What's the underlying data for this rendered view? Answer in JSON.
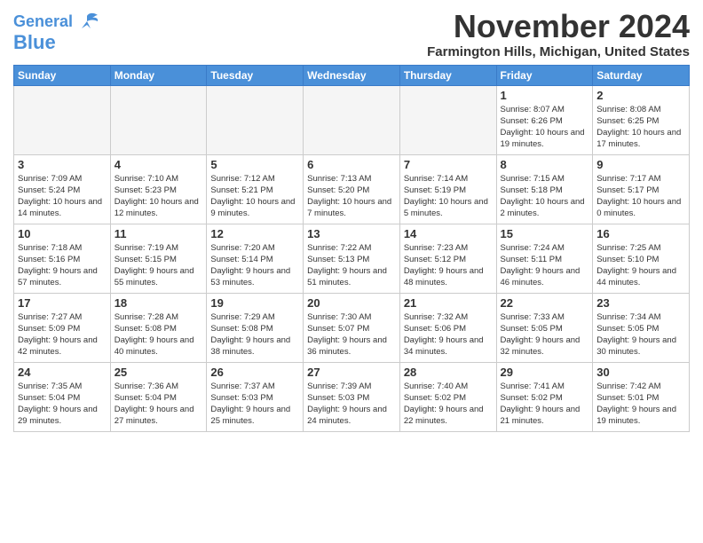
{
  "header": {
    "logo_line1": "General",
    "logo_line2": "Blue",
    "month": "November 2024",
    "location": "Farmington Hills, Michigan, United States"
  },
  "weekdays": [
    "Sunday",
    "Monday",
    "Tuesday",
    "Wednesday",
    "Thursday",
    "Friday",
    "Saturday"
  ],
  "weeks": [
    [
      {
        "day": "",
        "info": ""
      },
      {
        "day": "",
        "info": ""
      },
      {
        "day": "",
        "info": ""
      },
      {
        "day": "",
        "info": ""
      },
      {
        "day": "",
        "info": ""
      },
      {
        "day": "1",
        "info": "Sunrise: 8:07 AM\nSunset: 6:26 PM\nDaylight: 10 hours and 19 minutes."
      },
      {
        "day": "2",
        "info": "Sunrise: 8:08 AM\nSunset: 6:25 PM\nDaylight: 10 hours and 17 minutes."
      }
    ],
    [
      {
        "day": "3",
        "info": "Sunrise: 7:09 AM\nSunset: 5:24 PM\nDaylight: 10 hours and 14 minutes."
      },
      {
        "day": "4",
        "info": "Sunrise: 7:10 AM\nSunset: 5:23 PM\nDaylight: 10 hours and 12 minutes."
      },
      {
        "day": "5",
        "info": "Sunrise: 7:12 AM\nSunset: 5:21 PM\nDaylight: 10 hours and 9 minutes."
      },
      {
        "day": "6",
        "info": "Sunrise: 7:13 AM\nSunset: 5:20 PM\nDaylight: 10 hours and 7 minutes."
      },
      {
        "day": "7",
        "info": "Sunrise: 7:14 AM\nSunset: 5:19 PM\nDaylight: 10 hours and 5 minutes."
      },
      {
        "day": "8",
        "info": "Sunrise: 7:15 AM\nSunset: 5:18 PM\nDaylight: 10 hours and 2 minutes."
      },
      {
        "day": "9",
        "info": "Sunrise: 7:17 AM\nSunset: 5:17 PM\nDaylight: 10 hours and 0 minutes."
      }
    ],
    [
      {
        "day": "10",
        "info": "Sunrise: 7:18 AM\nSunset: 5:16 PM\nDaylight: 9 hours and 57 minutes."
      },
      {
        "day": "11",
        "info": "Sunrise: 7:19 AM\nSunset: 5:15 PM\nDaylight: 9 hours and 55 minutes."
      },
      {
        "day": "12",
        "info": "Sunrise: 7:20 AM\nSunset: 5:14 PM\nDaylight: 9 hours and 53 minutes."
      },
      {
        "day": "13",
        "info": "Sunrise: 7:22 AM\nSunset: 5:13 PM\nDaylight: 9 hours and 51 minutes."
      },
      {
        "day": "14",
        "info": "Sunrise: 7:23 AM\nSunset: 5:12 PM\nDaylight: 9 hours and 48 minutes."
      },
      {
        "day": "15",
        "info": "Sunrise: 7:24 AM\nSunset: 5:11 PM\nDaylight: 9 hours and 46 minutes."
      },
      {
        "day": "16",
        "info": "Sunrise: 7:25 AM\nSunset: 5:10 PM\nDaylight: 9 hours and 44 minutes."
      }
    ],
    [
      {
        "day": "17",
        "info": "Sunrise: 7:27 AM\nSunset: 5:09 PM\nDaylight: 9 hours and 42 minutes."
      },
      {
        "day": "18",
        "info": "Sunrise: 7:28 AM\nSunset: 5:08 PM\nDaylight: 9 hours and 40 minutes."
      },
      {
        "day": "19",
        "info": "Sunrise: 7:29 AM\nSunset: 5:08 PM\nDaylight: 9 hours and 38 minutes."
      },
      {
        "day": "20",
        "info": "Sunrise: 7:30 AM\nSunset: 5:07 PM\nDaylight: 9 hours and 36 minutes."
      },
      {
        "day": "21",
        "info": "Sunrise: 7:32 AM\nSunset: 5:06 PM\nDaylight: 9 hours and 34 minutes."
      },
      {
        "day": "22",
        "info": "Sunrise: 7:33 AM\nSunset: 5:05 PM\nDaylight: 9 hours and 32 minutes."
      },
      {
        "day": "23",
        "info": "Sunrise: 7:34 AM\nSunset: 5:05 PM\nDaylight: 9 hours and 30 minutes."
      }
    ],
    [
      {
        "day": "24",
        "info": "Sunrise: 7:35 AM\nSunset: 5:04 PM\nDaylight: 9 hours and 29 minutes."
      },
      {
        "day": "25",
        "info": "Sunrise: 7:36 AM\nSunset: 5:04 PM\nDaylight: 9 hours and 27 minutes."
      },
      {
        "day": "26",
        "info": "Sunrise: 7:37 AM\nSunset: 5:03 PM\nDaylight: 9 hours and 25 minutes."
      },
      {
        "day": "27",
        "info": "Sunrise: 7:39 AM\nSunset: 5:03 PM\nDaylight: 9 hours and 24 minutes."
      },
      {
        "day": "28",
        "info": "Sunrise: 7:40 AM\nSunset: 5:02 PM\nDaylight: 9 hours and 22 minutes."
      },
      {
        "day": "29",
        "info": "Sunrise: 7:41 AM\nSunset: 5:02 PM\nDaylight: 9 hours and 21 minutes."
      },
      {
        "day": "30",
        "info": "Sunrise: 7:42 AM\nSunset: 5:01 PM\nDaylight: 9 hours and 19 minutes."
      }
    ]
  ]
}
